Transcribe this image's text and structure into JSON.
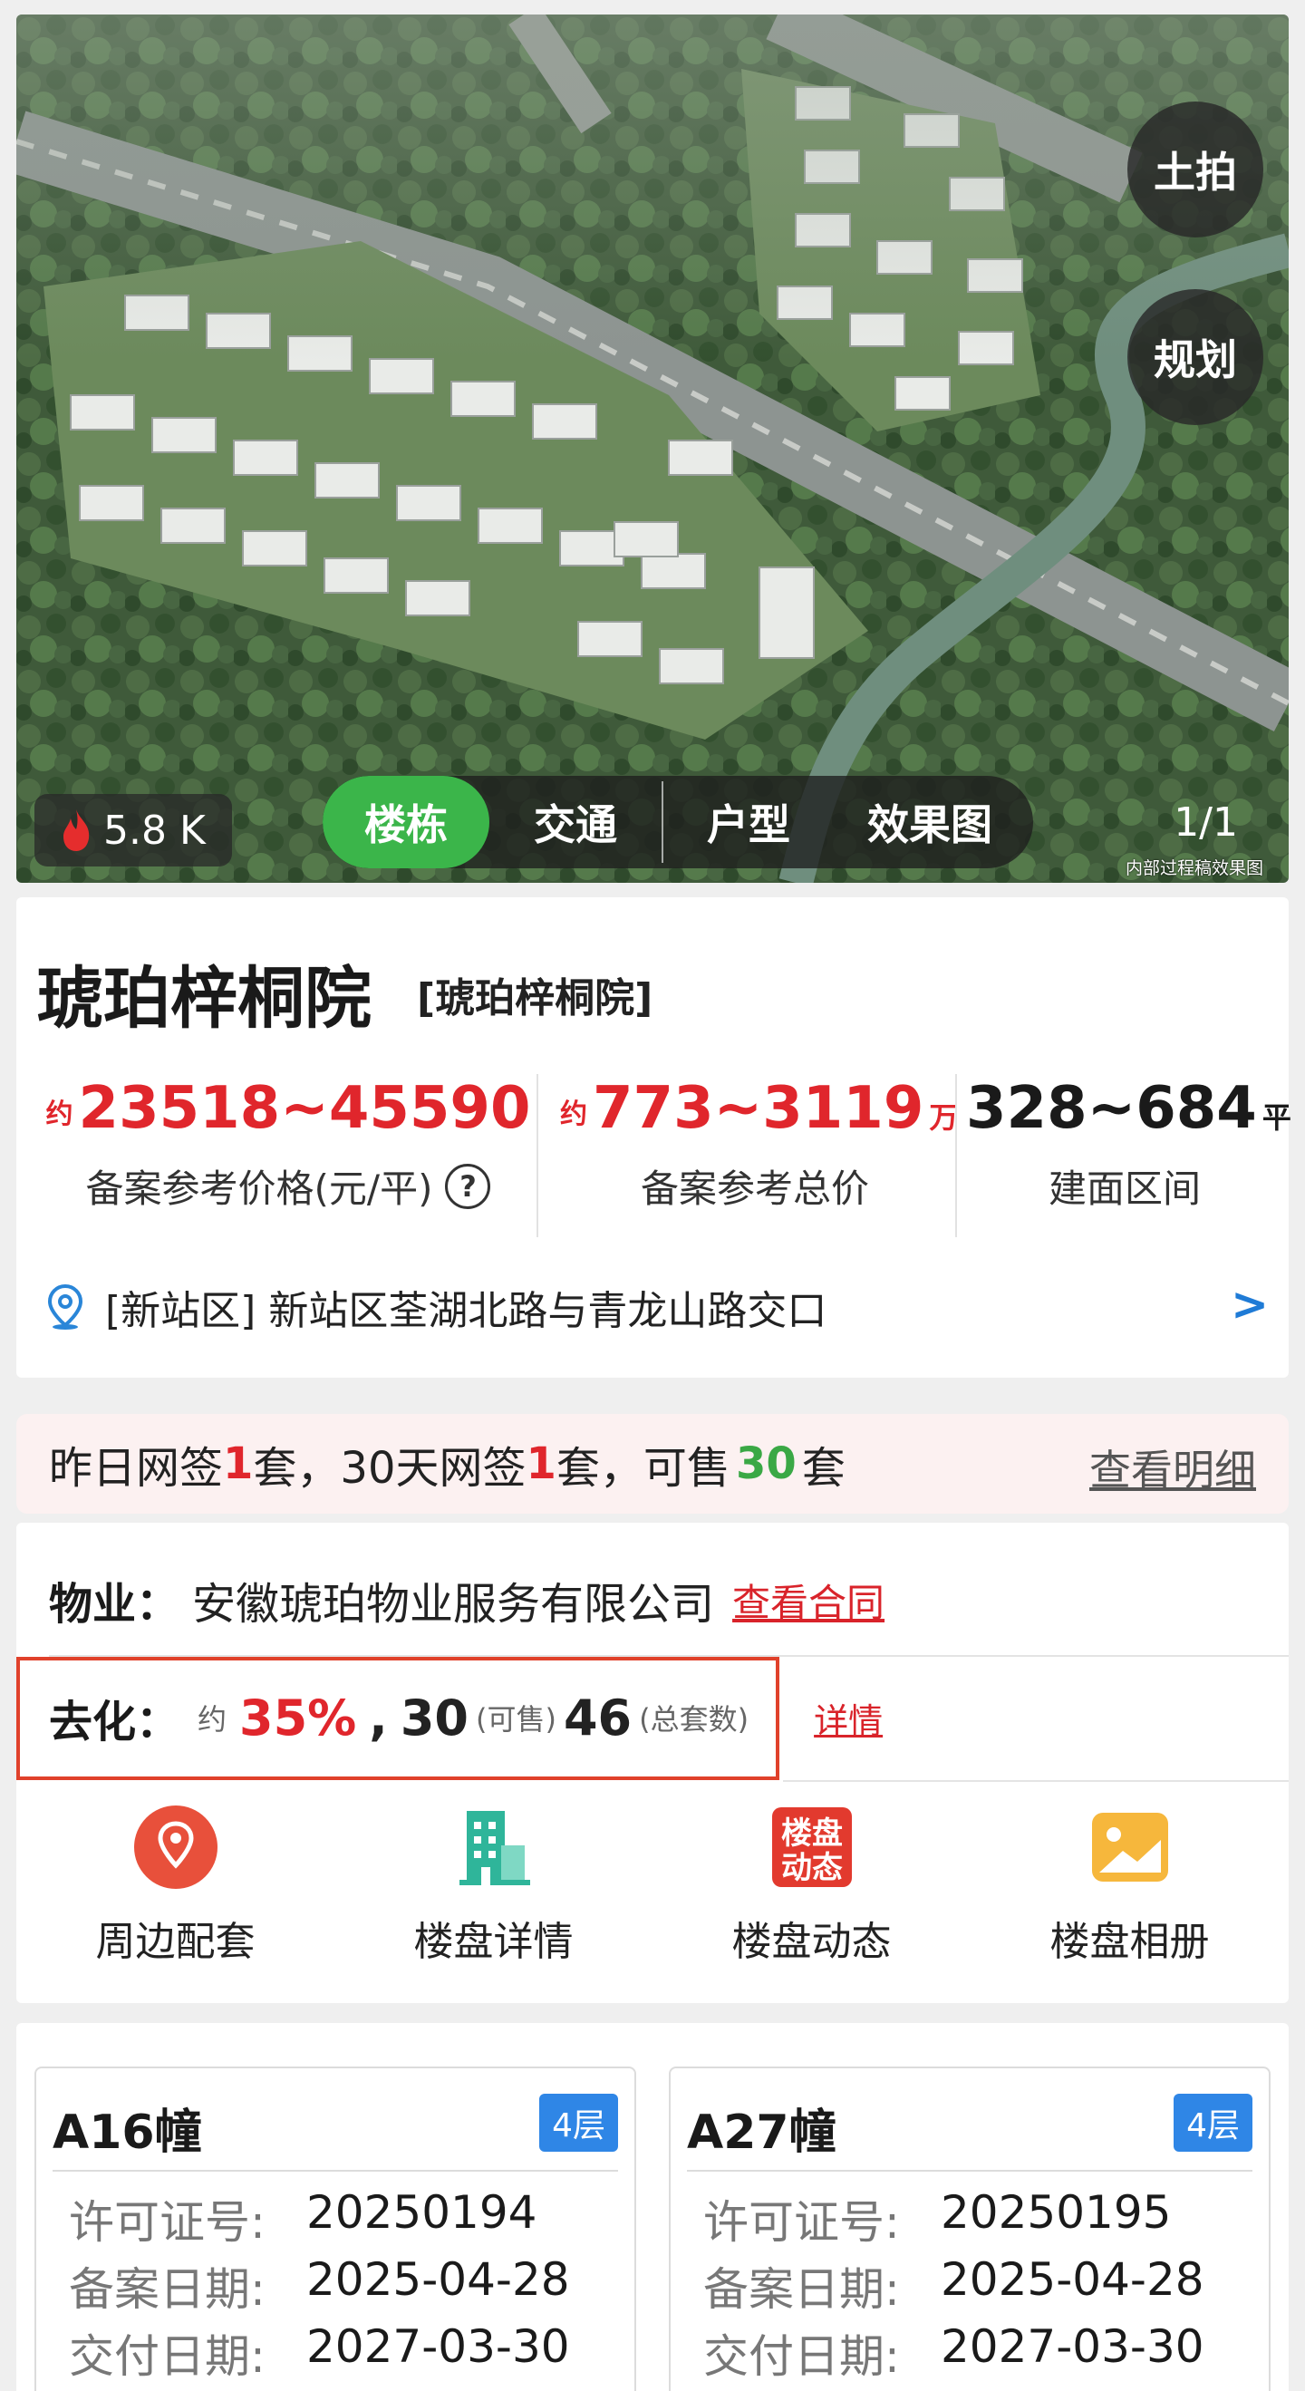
{
  "hero": {
    "chip_land": "土拍",
    "chip_plan": "规划",
    "heat": "5.8 K",
    "tabs": [
      "楼栋",
      "交通",
      "户型",
      "效果图"
    ],
    "pager": "1/1",
    "note": "内部过程稿效果图"
  },
  "project": {
    "name": "琥珀梓桐院",
    "alias": "[琥珀梓桐院]",
    "stats": [
      {
        "prefix": "约",
        "value": "23518~45590",
        "suffix": "",
        "label": "备案参考价格(元/平)"
      },
      {
        "prefix": "约",
        "value": "773~3119",
        "suffix": "万",
        "label": "备案参考总价"
      },
      {
        "prefix": "",
        "value": "328~684",
        "suffix": "平",
        "label": "建面区间"
      }
    ],
    "help_icon": "?",
    "address": "[新站区] 新站区荃湖北路与青龙山路交口",
    "address_chevron": ">"
  },
  "sales": {
    "p1": "昨日网签",
    "n1": "1",
    "p2": "套，30天网签",
    "n2": "1",
    "p3": "套，可售",
    "n3": "30",
    "p4": "套",
    "detail": "查看明细"
  },
  "property": {
    "mgmt_label": "物业：",
    "mgmt_value": "安徽琥珀物业服务有限公司",
    "contract_link": "查看合同",
    "rate_label": "去化：",
    "rate_prefix": "约",
    "rate_value": "35%",
    "rate_sep": ",",
    "available": "30",
    "available_unit": "(可售)",
    "total": "46",
    "total_unit": "(总套数)",
    "rate_link": "详情"
  },
  "shortcuts": [
    {
      "label": "周边配套",
      "icon": "location-pin-icon"
    },
    {
      "label": "楼盘详情",
      "icon": "building-icon"
    },
    {
      "label": "楼盘动态",
      "icon": "news-badge-icon"
    },
    {
      "label": "楼盘相册",
      "icon": "photo-album-icon"
    }
  ],
  "shortcut_badge": "楼盘动态",
  "buildings": [
    {
      "name": "A16幢",
      "floors": "4层",
      "permit_label": "许可证号:",
      "permit": "20250194",
      "record_label": "备案日期:",
      "record": "2025-04-28",
      "deliver_label": "交付日期:",
      "deliver": "2027-03-30"
    },
    {
      "name": "A27幢",
      "floors": "4层",
      "permit_label": "许可证号:",
      "permit": "20250195",
      "record_label": "备案日期:",
      "record": "2025-04-28",
      "deliver_label": "交付日期:",
      "deliver": "2027-03-30"
    }
  ],
  "colors": {
    "accent_red": "#e0262c",
    "accent_green": "#3bb54a",
    "accent_blue": "#2f86e6"
  }
}
